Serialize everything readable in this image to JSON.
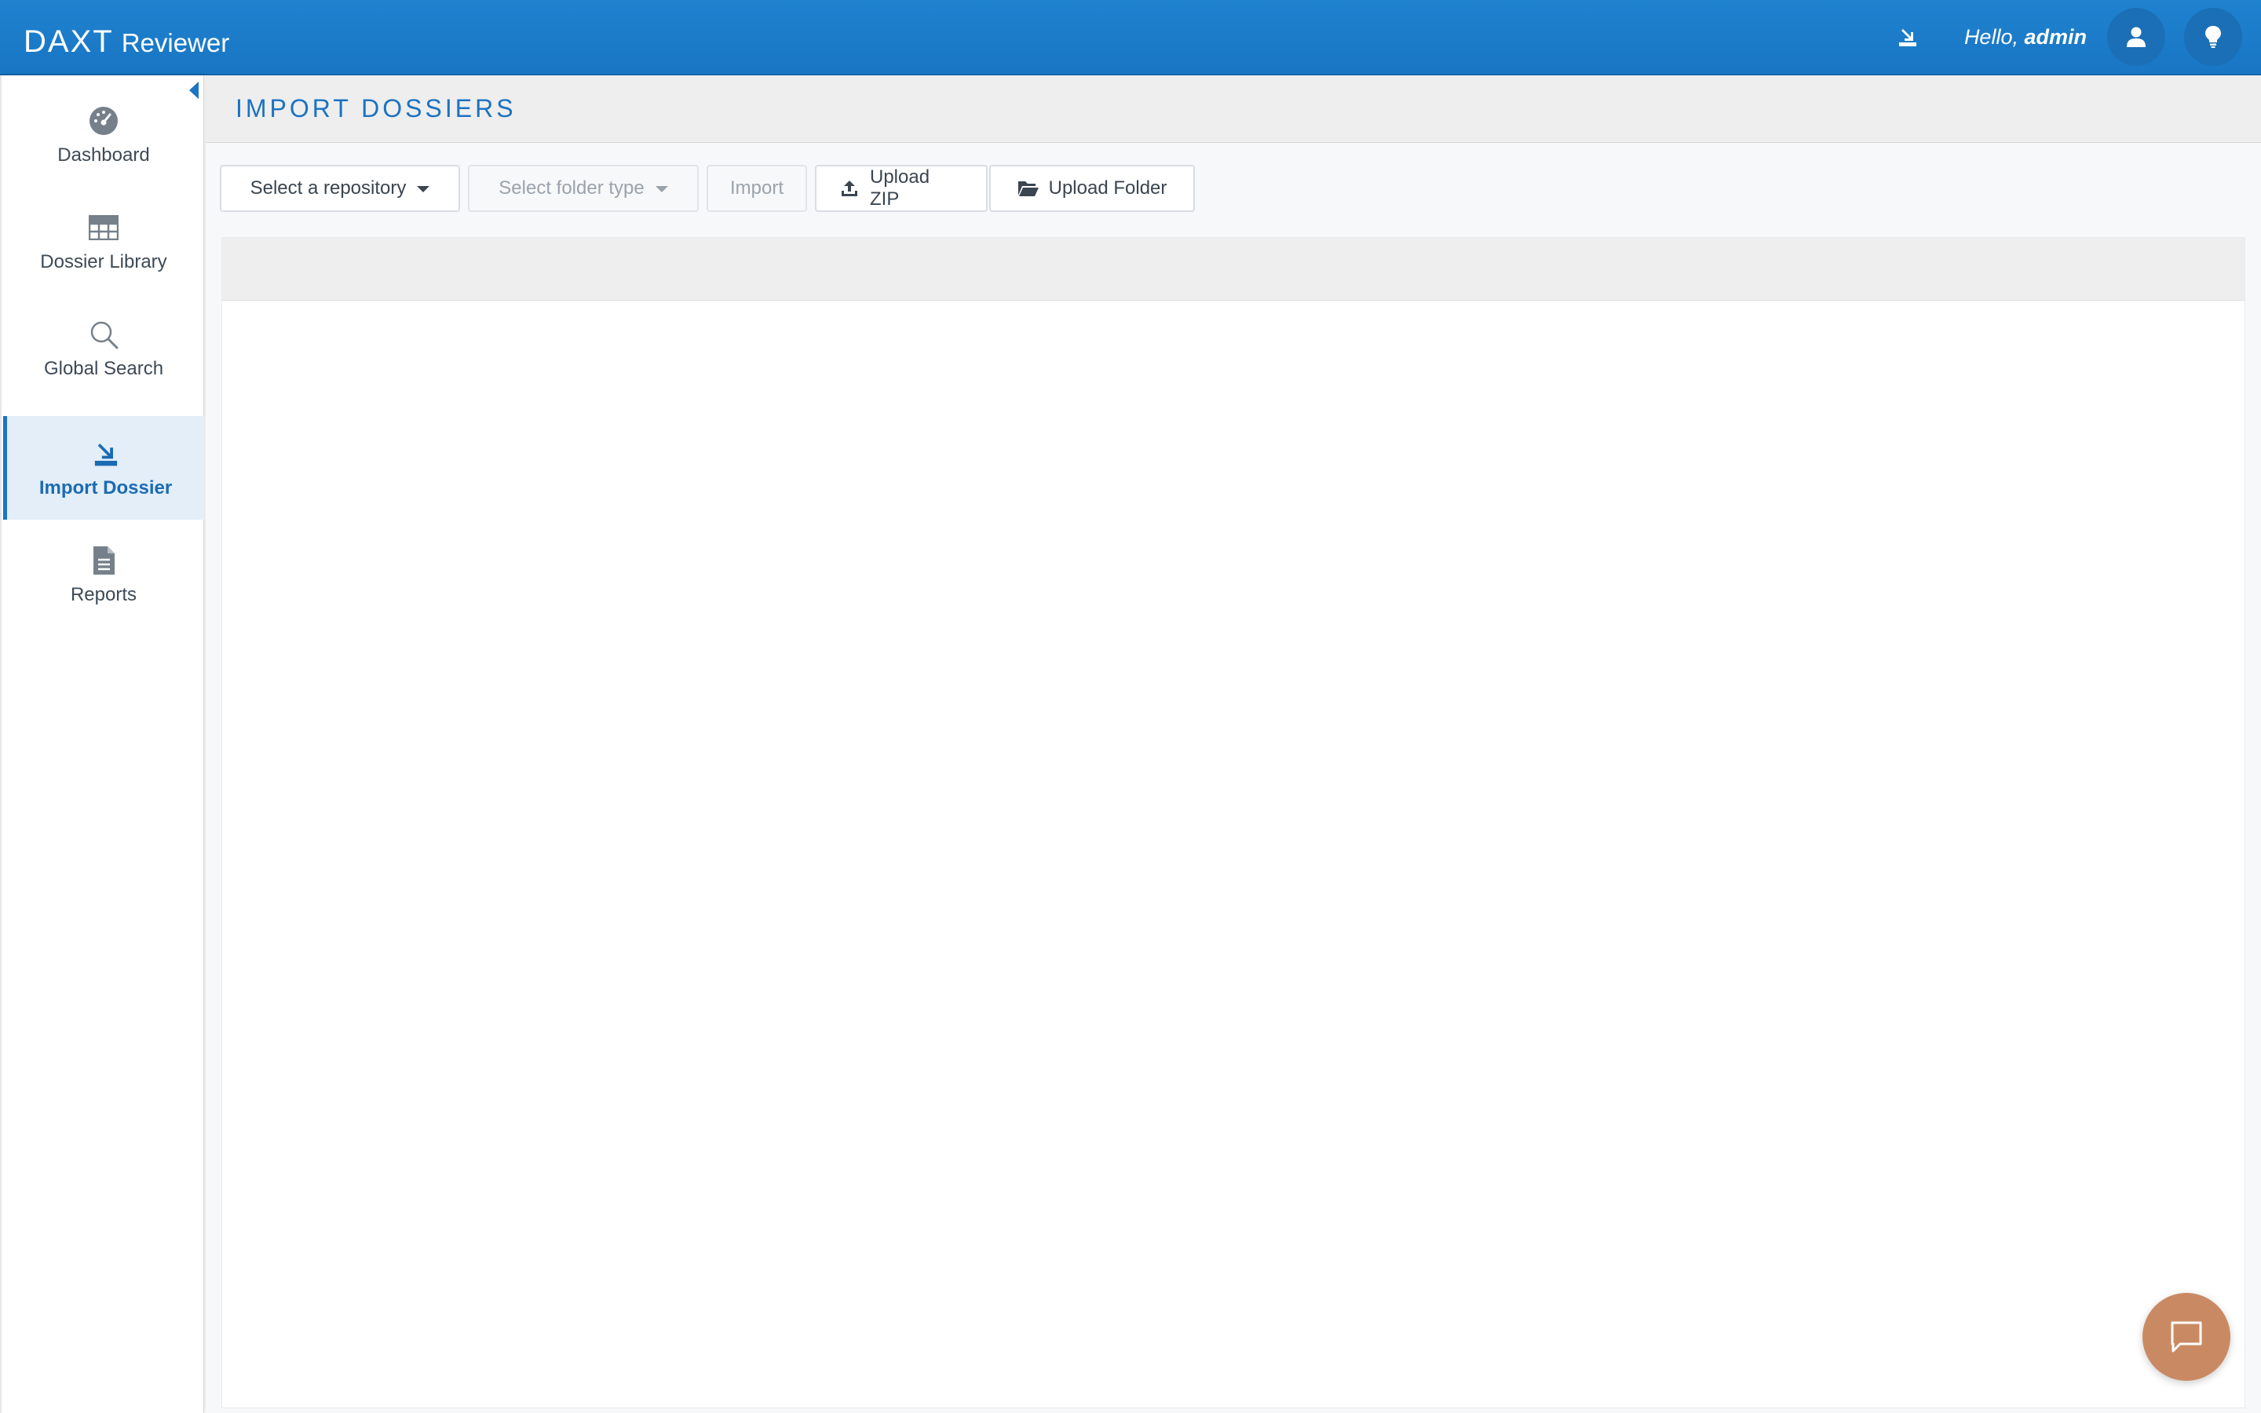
{
  "header": {
    "logo_text": "DAXT",
    "app_name": "Reviewer",
    "greeting_prefix": "Hello,",
    "username": "admin"
  },
  "sidebar": {
    "items": [
      {
        "label": "Dashboard",
        "icon": "dashboard-gauge-icon"
      },
      {
        "label": "Dossier Library",
        "icon": "grid-table-icon"
      },
      {
        "label": "Global Search",
        "icon": "search-icon"
      },
      {
        "label": "Import Dossier",
        "icon": "import-icon",
        "active": true
      },
      {
        "label": "Reports",
        "icon": "document-icon"
      }
    ]
  },
  "page": {
    "title": "IMPORT DOSSIERS"
  },
  "toolbar": {
    "repository_select": "Select a repository",
    "folder_type_select": "Select folder type",
    "import_label": "Import",
    "upload_zip_label": "Upload ZIP",
    "upload_folder_label": "Upload Folder"
  },
  "colors": {
    "header_blue": "#1f82cf",
    "accent_blue": "#1b74c4",
    "chat_button": "#c98a63"
  }
}
